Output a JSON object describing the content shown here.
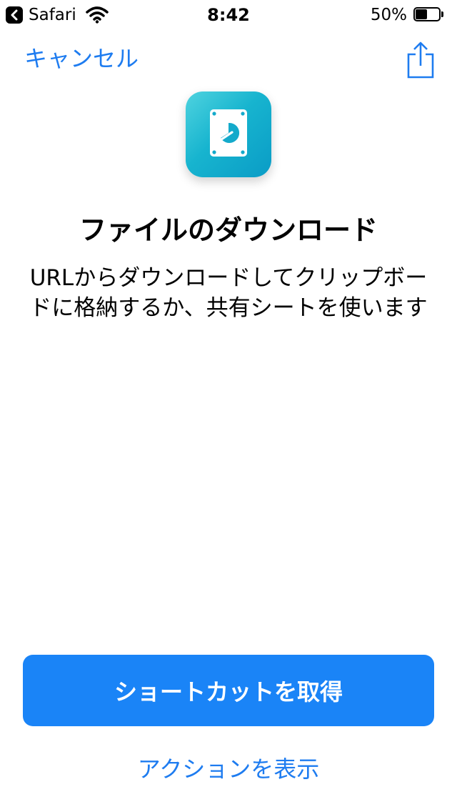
{
  "status_bar": {
    "back_app": "Safari",
    "time": "8:42",
    "battery_percent": "50%",
    "battery_level": 0.5,
    "icons": [
      "back-chevron-icon",
      "wifi-icon",
      "battery-icon"
    ]
  },
  "nav": {
    "cancel_label": "キャンセル",
    "share_icon": "share-icon"
  },
  "shortcut": {
    "icon": "hard-drive-icon",
    "icon_gradient": [
      "#4fd3df",
      "#0a9cc6"
    ],
    "title": "ファイルのダウンロード",
    "description": "URLからダウンロードしてクリップボードに格納するか、共有シートを使います"
  },
  "actions": {
    "get_button_label": "ショートカットを取得",
    "show_actions_label": "アクションを表示"
  },
  "colors": {
    "accent": "#1e7cf0",
    "button": "#1a84f7"
  }
}
